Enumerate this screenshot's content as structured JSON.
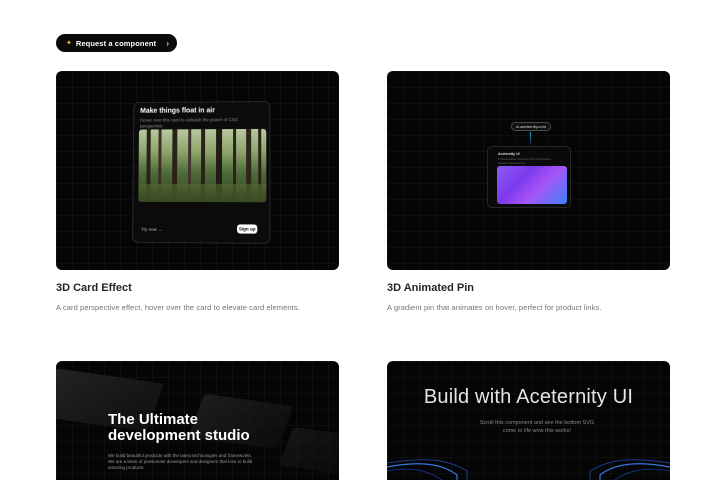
{
  "request_button": {
    "label": "Request a component",
    "icon": "sparkle-icon",
    "chevron": "›"
  },
  "cards": [
    {
      "title": "3D Card Effect",
      "description": "A card perspective effect, hover over the card to elevate card elements.",
      "preview": {
        "heading": "Make things float in air",
        "subtext": "Hover over this card to unleash the power of CSS perspective",
        "link": "Try now →",
        "button": "Sign up"
      }
    },
    {
      "title": "3D Animated Pin",
      "description": "A gradient pin that animates on hover, perfect for product links.",
      "preview": {
        "url": "ui.aceternity.com",
        "heading": "Aceternity UI",
        "subtext": "Customizable Tailwind CSS and Framer Motion Components."
      }
    },
    {
      "title": "",
      "description": "",
      "preview": {
        "heading_line1": "The Ultimate",
        "heading_line2": "development studio",
        "text": "We build beautiful products with the latest technologies and frameworks. We are a team of passionate developers and designers that love to build amazing products."
      }
    },
    {
      "title": "",
      "description": "",
      "preview": {
        "heading": "Build with Aceternity UI",
        "subtext": "Scroll this component and see the bottom SVG come to life wow this works!"
      }
    }
  ],
  "colors": {
    "page_bg": "#ffffff",
    "card_bg": "#050505",
    "accent_gradient_start": "#8b5cf6",
    "accent_gradient_end": "#3b82f6",
    "beam_blue": "#3b82f6"
  }
}
